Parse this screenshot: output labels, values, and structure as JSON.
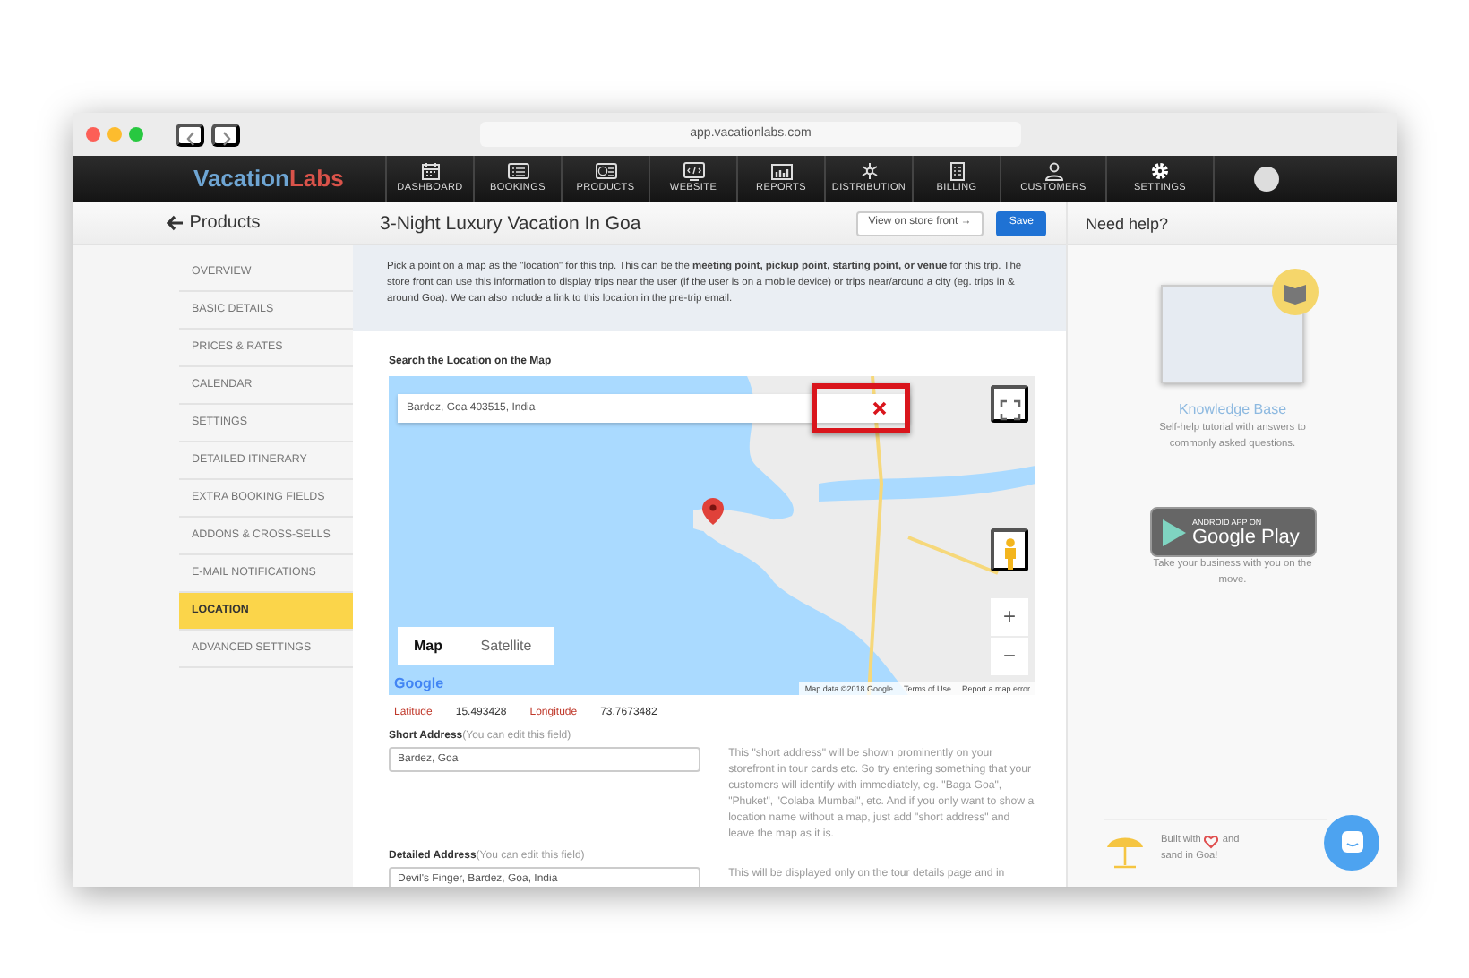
{
  "browser": {
    "url": "app.vacationlabs.com"
  },
  "logo": {
    "first": "Vacation",
    "second": "Labs"
  },
  "nav": [
    {
      "label": "DASHBOARD"
    },
    {
      "label": "BOOKINGS"
    },
    {
      "label": "PRODUCTS"
    },
    {
      "label": "WEBSITE"
    },
    {
      "label": "REPORTS"
    },
    {
      "label": "DISTRIBUTION"
    },
    {
      "label": "BILLING"
    },
    {
      "label": "CUSTOMERS"
    },
    {
      "label": "SETTINGS"
    }
  ],
  "back_link": "Products",
  "page_title": "3-Night Luxury Vacation In Goa",
  "buttons": {
    "store_front": "View on store front →",
    "save": "Save"
  },
  "sidebar": [
    {
      "label": "OVERVIEW",
      "selected": false
    },
    {
      "label": "BASIC DETAILS",
      "selected": false
    },
    {
      "label": "PRICES & RATES",
      "selected": false
    },
    {
      "label": "CALENDAR",
      "selected": false
    },
    {
      "label": "SETTINGS",
      "selected": false
    },
    {
      "label": "DETAILED ITINERARY",
      "selected": false
    },
    {
      "label": "EXTRA BOOKING FIELDS",
      "selected": false
    },
    {
      "label": "ADDONS & CROSS-SELLS",
      "selected": false
    },
    {
      "label": "E-MAIL NOTIFICATIONS",
      "selected": false
    },
    {
      "label": "LOCATION",
      "selected": true
    },
    {
      "label": "ADVANCED SETTINGS",
      "selected": false
    }
  ],
  "intro": "Pick a point on a map as the \"location\" for this trip. This can be the **meeting point, pickup point, starting point, or venue** for this trip. The store front can use this information to display trips near the user (if the user is on a mobile device) or trips near/around a city (eg. trips in & around Goa). We can also include a link to this location in the pre-trip email.",
  "map_section": {
    "title": "Search the Location on the Map",
    "search_value": "Bardez, Goa 403515, India",
    "clear_highlighted": true,
    "map_types": [
      {
        "label": "Map",
        "selected": true
      },
      {
        "label": "Satellite",
        "selected": false
      }
    ],
    "zoom_in": "+",
    "zoom_out": "−",
    "google_logo": "Google",
    "attribution": [
      "Map data ©2018 Google",
      "Terms of Use",
      "Report a map error"
    ]
  },
  "coordinates": {
    "latitude_label": "Latitude",
    "latitude": "15.493428",
    "longitude_label": "Longitude",
    "longitude": "73.7673482"
  },
  "fields": [
    {
      "label": "Short Address",
      "hint": "(You can edit this field)",
      "value": "Bardez, Goa",
      "help": "This \"short address\" will be shown prominently on your storefront in tour cards etc. So try entering something that your customers will identify with immediately, eg. \"Baga Goa\", \"Phuket\", \"Colaba Mumbai\", etc. And if you only want to show a location name without a map, just add \"short address\" and leave the map as it is."
    },
    {
      "label": "Detailed Address",
      "hint": "(You can edit this field)",
      "value": "Devil's Finger, Bardez, Goa, India",
      "help": "This will be displayed only on the tour details page and in"
    }
  ],
  "help_panel": {
    "title": "Need help?",
    "knowledge_base": {
      "title": "Knowledge Base",
      "text": "Self-help tutorial with answers to commonly asked questions."
    },
    "app_badge": {
      "small": "ANDROID APP ON",
      "big": "Google Play"
    },
    "app_text": "Take your business with you on the move.",
    "footer": {
      "before": "Built with",
      "after": "and",
      "line2": "sand in Goa!"
    }
  }
}
